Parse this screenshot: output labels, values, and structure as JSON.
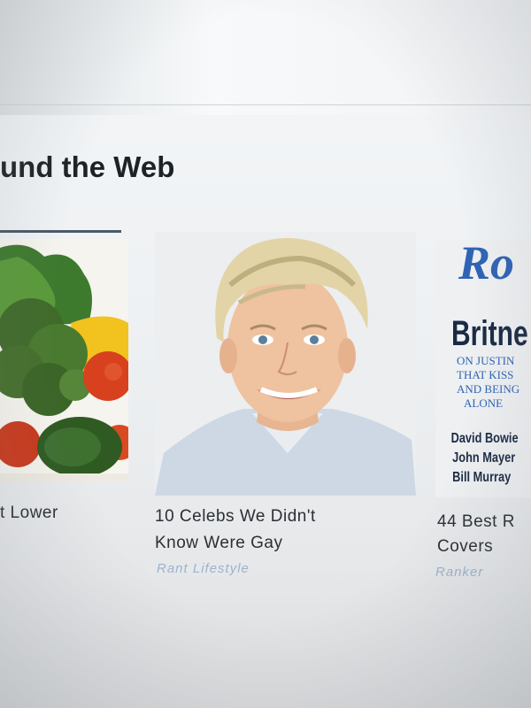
{
  "section": {
    "title": "und the Web"
  },
  "cards": [
    {
      "title_line1": "t Lower",
      "title_line2": "",
      "source": "",
      "image": "vegetables"
    },
    {
      "title_line1": "10 Celebs We Didn't",
      "title_line2": "Know Were Gay",
      "source": "Rant Lifestyle",
      "image": "portrait"
    },
    {
      "title_line1": "44 Best R",
      "title_line2": "Covers",
      "source": "Ranker",
      "image": "magazine-cover"
    }
  ],
  "magazine": {
    "logo": "Ro",
    "headline": "Britne",
    "sub1": "ON JUSTIN",
    "sub2": "THAT KISS",
    "sub3": "AND BEING",
    "sub4": "ALONE",
    "name1": "David Bowie",
    "name2": "John Mayer",
    "name3": "Bill Murray"
  },
  "colors": {
    "source_link": "#9db3cc",
    "title_text": "#1e2226",
    "underline": "#4a5866"
  }
}
